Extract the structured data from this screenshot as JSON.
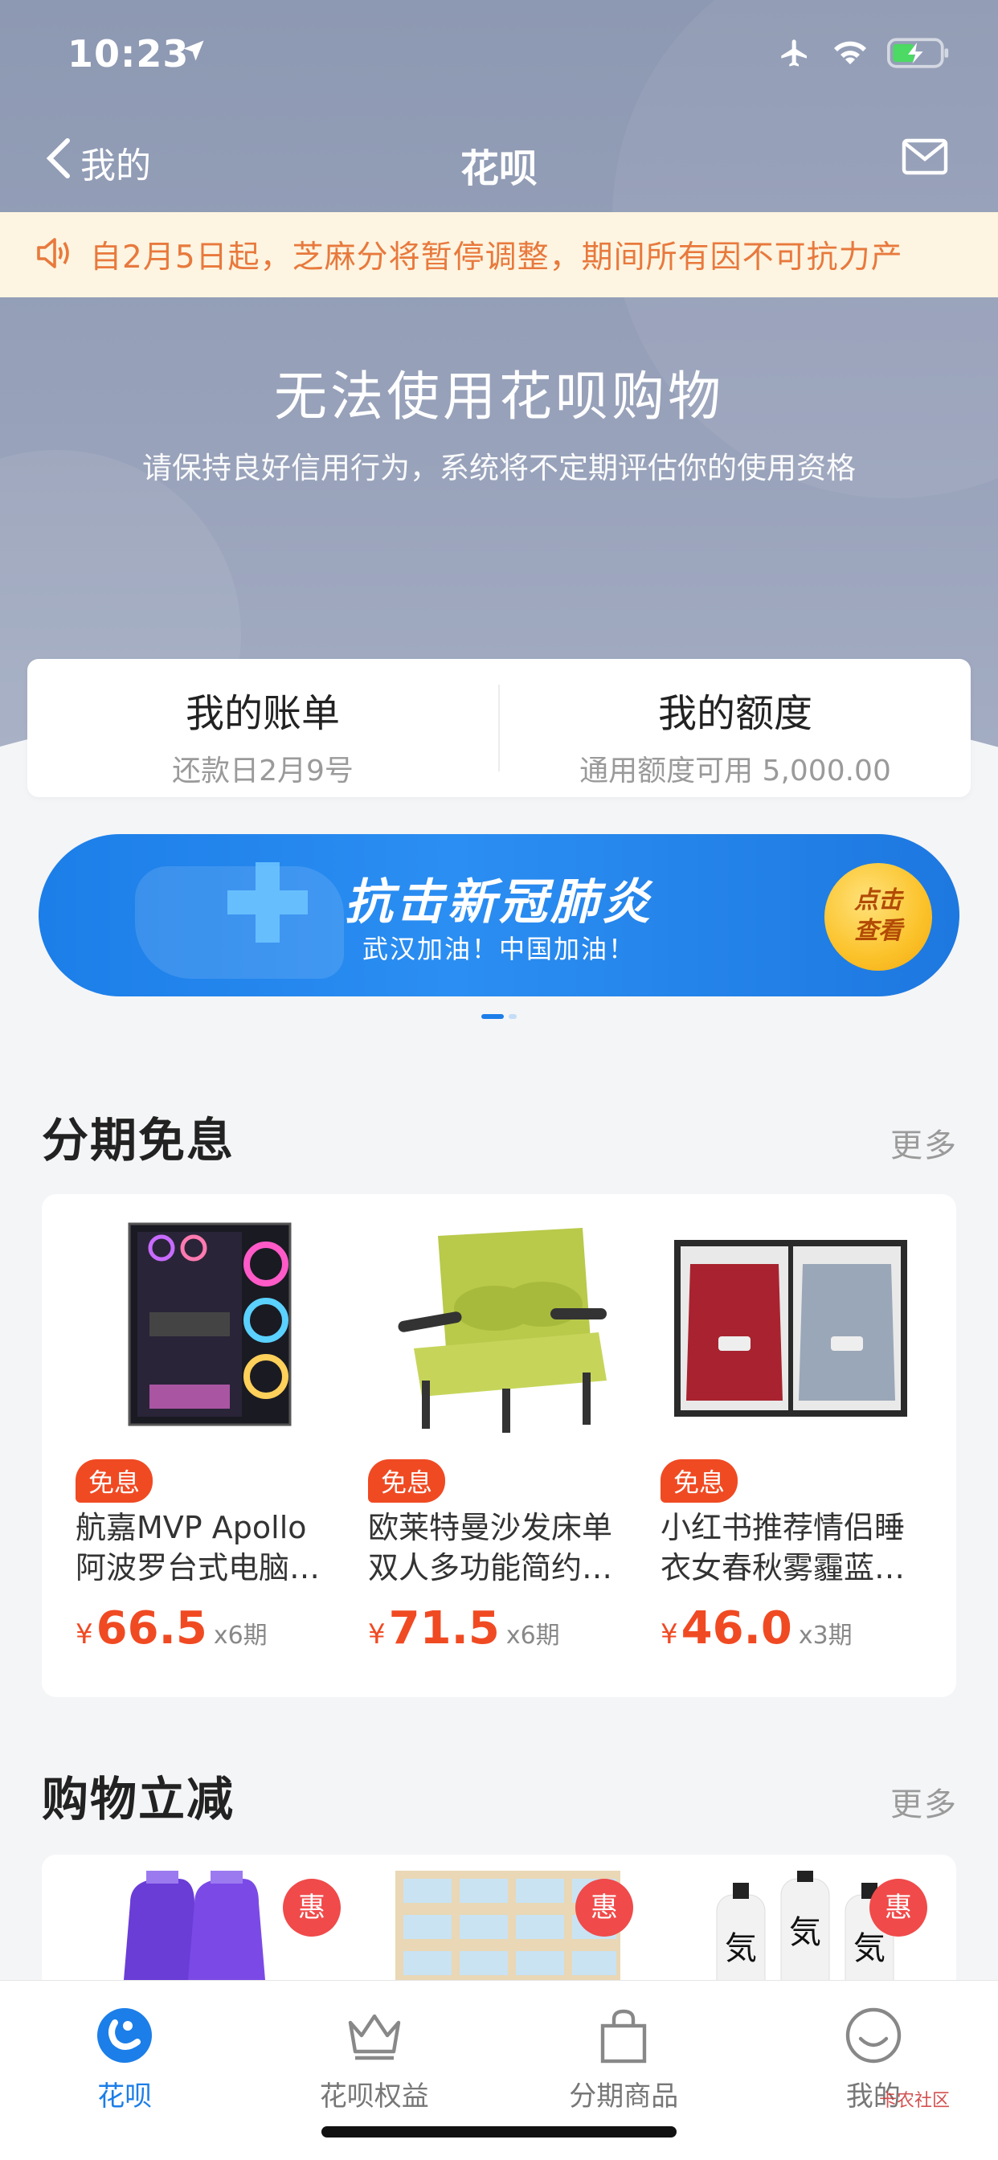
{
  "status_bar": {
    "time": "10:23"
  },
  "nav": {
    "back_label": "我的",
    "title": "花呗"
  },
  "notice": {
    "text": "自2月5日起，芝麻分将暂停调整，期间所有因不可抗力产"
  },
  "hero": {
    "title": "无法使用花呗购物",
    "subtitle": "请保持良好信用行为，系统将不定期评估你的使用资格"
  },
  "summary": {
    "bill_label": "我的账单",
    "bill_sub": "还款日2月9号",
    "quota_label": "我的额度",
    "quota_sub": "通用额度可用 5,000.00"
  },
  "banner": {
    "title": "抗击新冠肺炎",
    "subtitle": "武汉加油！中国加油！",
    "cta_line1": "点击",
    "cta_line2": "查看"
  },
  "section1": {
    "title": "分期免息",
    "more": "更多",
    "products": [
      {
        "tag": "免息",
        "name1": "航嘉MVP Apollo",
        "name2": "阿波罗台式电脑…",
        "yen": "¥",
        "price": "66.5",
        "installments": "x6期"
      },
      {
        "tag": "免息",
        "name1": "欧莱特曼沙发床单",
        "name2": "双人多功能简约…",
        "yen": "¥",
        "price": "71.5",
        "installments": "x6期"
      },
      {
        "tag": "免息",
        "name1": "小红书推荐情侣睡",
        "name2": "衣女春秋雾霾蓝…",
        "yen": "¥",
        "price": "46.0",
        "installments": "x3期"
      }
    ]
  },
  "section2": {
    "title": "购物立减",
    "more": "更多",
    "badge": "惠"
  },
  "tabbar": [
    {
      "label": "花呗",
      "icon": "huabei-icon",
      "active": true
    },
    {
      "label": "花呗权益",
      "icon": "crown-icon"
    },
    {
      "label": "分期商品",
      "icon": "shopping-bag-icon"
    },
    {
      "label": "我的",
      "icon": "smiley-icon"
    }
  ],
  "watermark": "卡农社区",
  "colors": {
    "accent": "#1c7ee8",
    "price": "#f04a23",
    "notice_text": "#e8793d",
    "hero_bg": "#98a2ba"
  }
}
